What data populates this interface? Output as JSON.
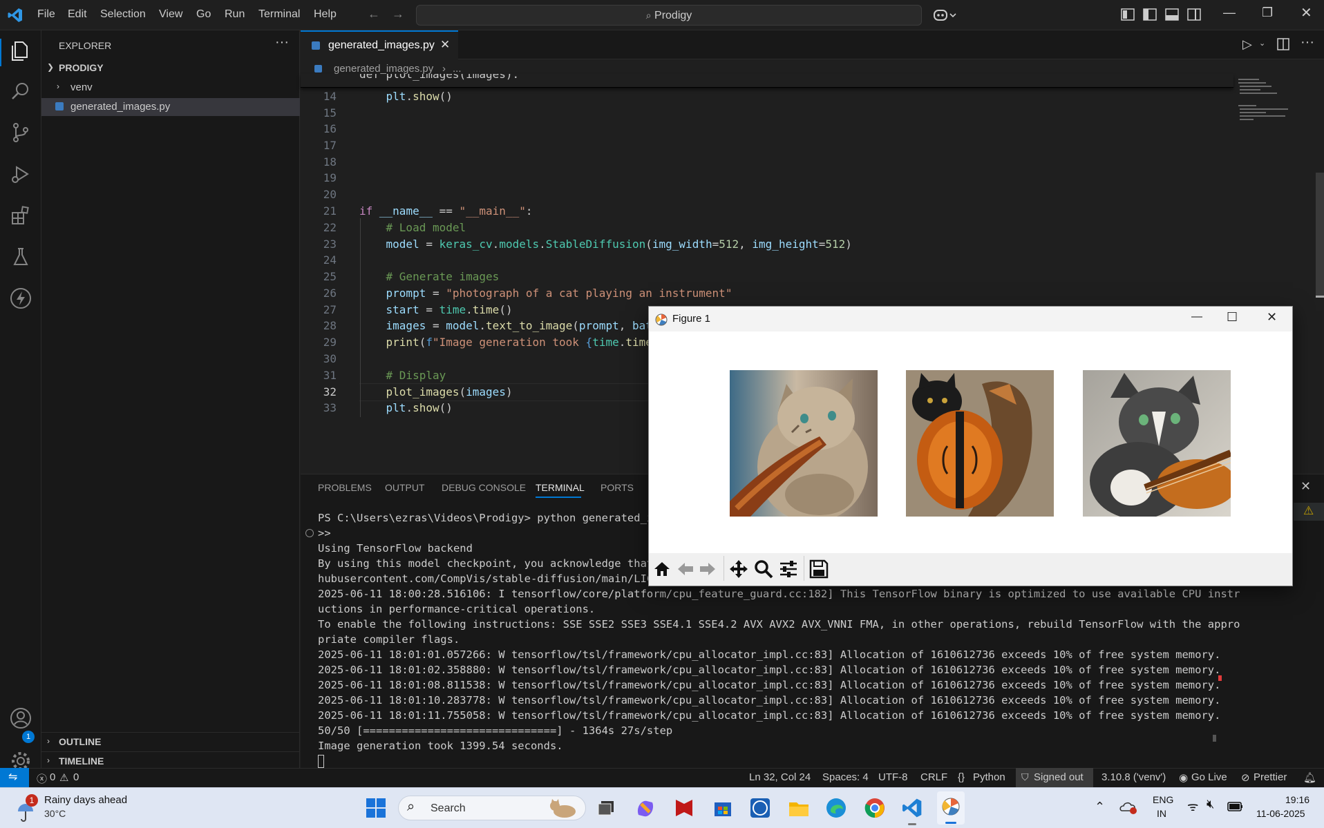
{
  "titlebar": {
    "menu": [
      "File",
      "Edit",
      "Selection",
      "View",
      "Go",
      "Run",
      "Terminal",
      "Help"
    ],
    "search_text": "Prodigy"
  },
  "sidebar": {
    "header": "EXPLORER",
    "project": "PRODIGY",
    "items": [
      {
        "label": "venv"
      },
      {
        "label": "generated_images.py"
      }
    ],
    "outline": "OUTLINE",
    "timeline": "TIMELINE",
    "accounts_badge": "1"
  },
  "editor": {
    "tab_label": "generated_images.py",
    "breadcrumb_file": "generated_images.py",
    "breadcrumb_more": "...",
    "sticky_line": "def plot_images(images):",
    "lines": [
      {
        "n": "14",
        "code": "    plt.show()"
      },
      {
        "n": "15",
        "code": ""
      },
      {
        "n": "16",
        "code": ""
      },
      {
        "n": "17",
        "code": ""
      },
      {
        "n": "18",
        "code": ""
      },
      {
        "n": "19",
        "code": ""
      },
      {
        "n": "20",
        "code": ""
      },
      {
        "n": "21",
        "code": "if __name__ == \"__main__\":"
      },
      {
        "n": "22",
        "code": "    # Load model"
      },
      {
        "n": "23",
        "code": "    model = keras_cv.models.StableDiffusion(img_width=512, img_height=512)"
      },
      {
        "n": "24",
        "code": ""
      },
      {
        "n": "25",
        "code": "    # Generate images"
      },
      {
        "n": "26",
        "code": "    prompt = \"photograph of a cat playing an instrument\""
      },
      {
        "n": "27",
        "code": "    start = time.time()"
      },
      {
        "n": "28",
        "code": "    images = model.text_to_image(prompt, bat"
      },
      {
        "n": "29",
        "code": "    print(f\"Image generation took {time.time"
      },
      {
        "n": "30",
        "code": ""
      },
      {
        "n": "31",
        "code": "    # Display"
      },
      {
        "n": "32",
        "code": "    plot_images(images)"
      },
      {
        "n": "33",
        "code": "    plt.show()"
      }
    ]
  },
  "panel": {
    "tabs": [
      "PROBLEMS",
      "OUTPUT",
      "DEBUG CONSOLE",
      "TERMINAL",
      "PORTS"
    ],
    "active_tab": "TERMINAL",
    "terminal_lines": [
      "PS C:\\Users\\ezras\\Videos\\Prodigy> python generated_im",
      ">>",
      "Using TensorFlow backend",
      "By using this model checkpoint, you acknowledge that",
      "hubusercontent.com/CompVis/stable-diffusion/main/LICE",
      "2025-06-11 18:00:28.516106: I tensorflow/core/platform/cpu_feature_guard.cc:182] This TensorFlow binary is optimized to use available CPU instr",
      "uctions in performance-critical operations.",
      "To enable the following instructions: SSE SSE2 SSE3 SSE4.1 SSE4.2 AVX AVX2 AVX_VNNI FMA, in other operations, rebuild TensorFlow with the appro",
      "priate compiler flags.",
      "2025-06-11 18:01:01.057266: W tensorflow/tsl/framework/cpu_allocator_impl.cc:83] Allocation of 1610612736 exceeds 10% of free system memory.",
      "2025-06-11 18:01:02.358880: W tensorflow/tsl/framework/cpu_allocator_impl.cc:83] Allocation of 1610612736 exceeds 10% of free system memory.",
      "2025-06-11 18:01:08.811538: W tensorflow/tsl/framework/cpu_allocator_impl.cc:83] Allocation of 1610612736 exceeds 10% of free system memory.",
      "2025-06-11 18:01:10.283778: W tensorflow/tsl/framework/cpu_allocator_impl.cc:83] Allocation of 1610612736 exceeds 10% of free system memory.",
      "2025-06-11 18:01:11.755058: W tensorflow/tsl/framework/cpu_allocator_impl.cc:83] Allocation of 1610612736 exceeds 10% of free system memory.",
      "50/50 [==============================] - 1364s 27s/step",
      "Image generation took 1399.54 seconds."
    ]
  },
  "figure": {
    "title": "Figure 1"
  },
  "statusbar": {
    "errors": "0",
    "warnings": "0",
    "position": "Ln 32, Col 24",
    "spaces": "Spaces: 4",
    "encoding": "UTF-8",
    "eol": "CRLF",
    "language": "Python",
    "signed_out": "Signed out",
    "interpreter": "3.10.8 ('venv')",
    "go_live": "Go Live",
    "prettier": "Prettier"
  },
  "taskbar": {
    "weather_title": "Rainy days ahead",
    "weather_temp": "30°C",
    "weather_badge": "1",
    "search_placeholder": "Search",
    "lang_top": "ENG",
    "lang_bottom": "IN",
    "time": "19:16",
    "date": "11-06-2025"
  },
  "colors": {
    "accent": "#0078d4",
    "editor_bg": "#1f1f1f",
    "sidebar_bg": "#181818"
  }
}
